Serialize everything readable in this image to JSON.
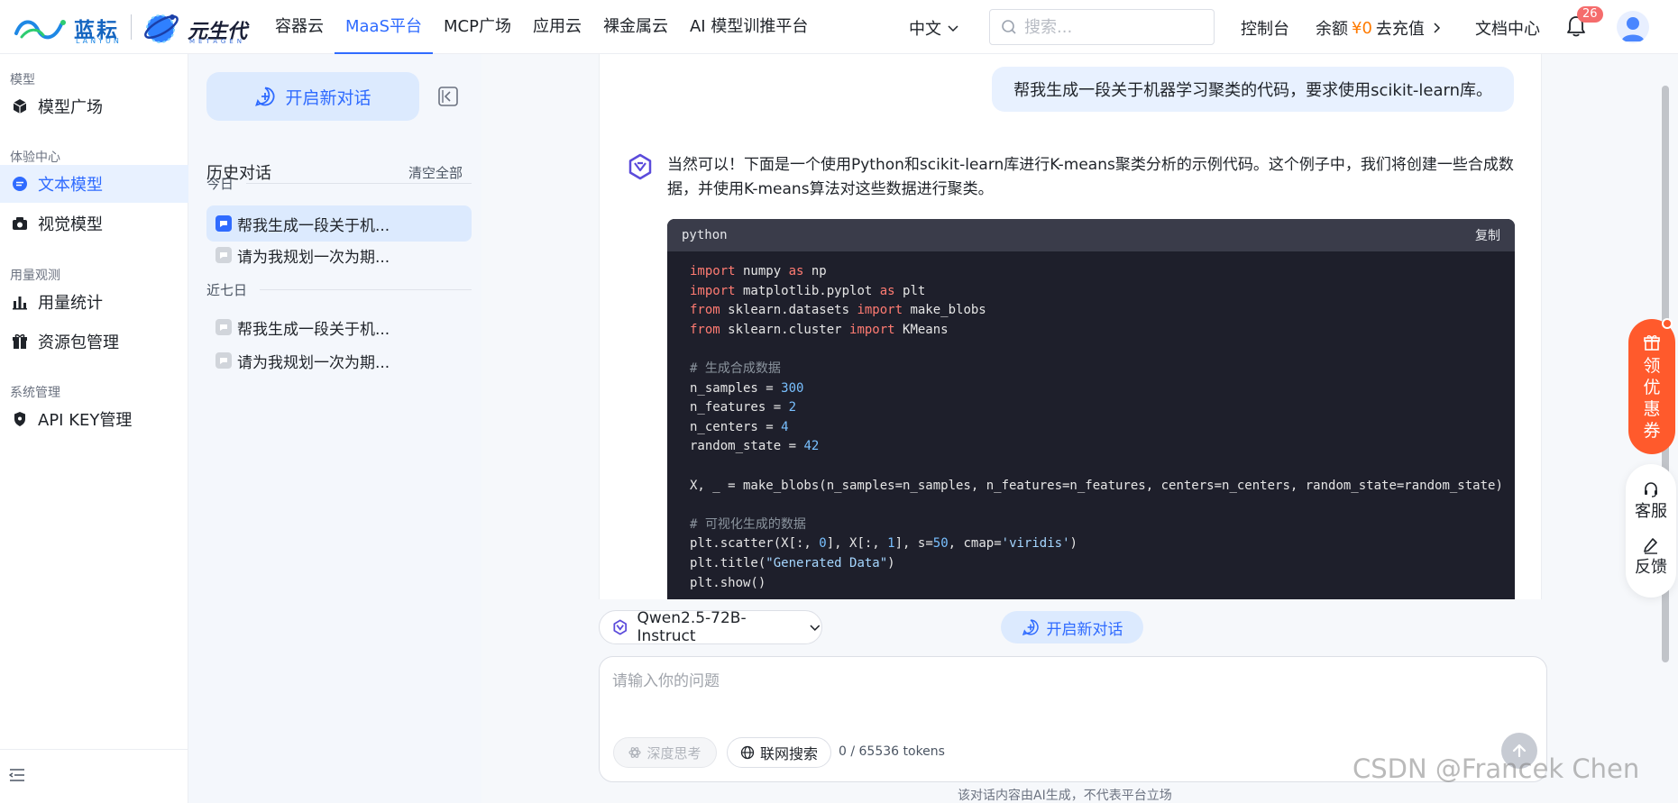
{
  "brand": {
    "lanyun_cn": "蓝耘",
    "lanyun_en": "LANYUN",
    "yuan_cn": "元生代",
    "yuan_en": "METAGEN"
  },
  "nav": {
    "items": [
      "容器云",
      "MaaS平台",
      "MCP广场",
      "应用云",
      "裸金属云",
      "AI 模型训推平台"
    ],
    "active_index": 1
  },
  "header": {
    "language": "中文",
    "search_placeholder": "搜索...",
    "console": "控制台",
    "balance_label": "余额",
    "balance_amount": "¥0",
    "recharge": "去充值",
    "docs": "文档中心",
    "notification_count": "26"
  },
  "sidebar": {
    "groups": [
      {
        "label": "模型",
        "items": [
          {
            "label": "模型广场",
            "icon": "cube-icon"
          }
        ]
      },
      {
        "label": "体验中心",
        "items": [
          {
            "label": "文本模型",
            "icon": "chat-bubble-icon",
            "active": true
          },
          {
            "label": "视觉模型",
            "icon": "camera-icon"
          }
        ]
      },
      {
        "label": "用量观测",
        "items": [
          {
            "label": "用量统计",
            "icon": "bar-chart-icon"
          },
          {
            "label": "资源包管理",
            "icon": "gift-icon"
          }
        ]
      },
      {
        "label": "系统管理",
        "items": [
          {
            "label": "API KEY管理",
            "icon": "shield-icon"
          }
        ]
      }
    ]
  },
  "history": {
    "new_chat": "开启新对话",
    "title": "历史对话",
    "clear_all": "清空全部",
    "sections": [
      {
        "label": "今日",
        "items": [
          "帮我生成一段关于机...",
          "请为我规划一次为期..."
        ]
      },
      {
        "label": "近七日",
        "items": [
          "帮我生成一段关于机...",
          "请为我规划一次为期..."
        ]
      }
    ]
  },
  "chat": {
    "user_message": "帮我生成一段关于机器学习聚类的代码，要求使用scikit-learn库。",
    "bot_message": "当然可以！下面是一个使用Python和scikit-learn库进行K-means聚类分析的示例代码。这个例子中，我们将创建一些合成数据，并使用K-means算法对这些数据进行聚类。",
    "code_lang": "python",
    "code_copy": "复制"
  },
  "composer": {
    "model": "Qwen2.5-72B-Instruct",
    "new_chat": "开启新对话",
    "placeholder": "请输入你的问题",
    "deep_think": "深度思考",
    "web_search": "联网搜索",
    "tokens": "0 / 65536 tokens",
    "disclaimer": "该对话内容由AI生成，不代表平台立场"
  },
  "float_tools": {
    "coupon": "领优惠券",
    "service": "客服",
    "feedback": "反馈"
  },
  "watermark": "CSDN @Francek Chen",
  "colors": {
    "primary": "#2f6bff",
    "accent_orange": "#ff5a2c",
    "active_bg": "#e8f1ff",
    "code_bg": "#1e1f2b"
  }
}
